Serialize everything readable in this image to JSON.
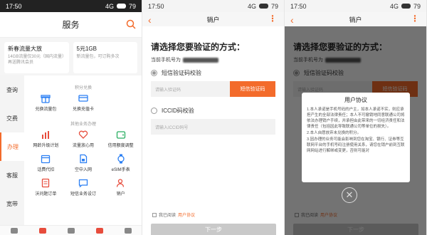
{
  "status": {
    "time": "17:50",
    "signal": "4G",
    "battery": "79"
  },
  "services": {
    "title": "服务",
    "promo": [
      {
        "title": "新春流量大放",
        "sub": "14GB流量仅30元（国内流量）再送腾讯会员"
      },
      {
        "title": "5元1GB",
        "sub": "新流量包，可订购多次"
      }
    ],
    "sidebar": [
      "查询",
      "交费",
      "办理",
      "客服",
      "宽带"
    ],
    "active_index": 2,
    "sections": [
      {
        "title": "积分兑换",
        "items": [
          {
            "label": "兑换流量包",
            "icon": "gift-icon"
          },
          {
            "label": "兑换充值卡",
            "icon": "card-icon"
          }
        ]
      },
      {
        "title": "其他业务办理",
        "items": [
          {
            "label": "网龄升级计划",
            "icon": "chart-icon"
          },
          {
            "label": "流量放心用",
            "icon": "heart-icon"
          },
          {
            "label": "信用额度调整",
            "icon": "wallet-icon"
          },
          {
            "label": "话费代扣",
            "icon": "calendar-icon"
          },
          {
            "label": "空中入网",
            "icon": "sim-icon"
          },
          {
            "label": "eSIM手表",
            "icon": "watch-icon"
          },
          {
            "label": "沃问题订单",
            "icon": "document-icon"
          },
          {
            "label": "短信业务设订",
            "icon": "message-icon"
          },
          {
            "label": "销户",
            "icon": "user-remove-icon"
          }
        ]
      }
    ]
  },
  "verify": {
    "title": "销户",
    "heading": "请选择您要验证的方式：",
    "phone_label": "当前手机号为",
    "sms_option": "短信验证码校验",
    "sms_placeholder": "请输入验证码",
    "sms_button": "短信验证码",
    "iccid_option": "ICCID码校验",
    "iccid_placeholder": "请输入ICCID码号",
    "agree_prefix": "我已阅读",
    "agree_link": "用户协议",
    "next": "下一步"
  },
  "agreement": {
    "title": "用户协议",
    "paragraphs": [
      "1.本人承诺是手机号码的户主，如本人承诺不实，则应承担产生的全部法律责任；本人不可撤销地同意联通公司将依法办理销户手续，并承担由此带来的一切经济责任和法律责任（包括因此导致联通公司等单位的损失）。",
      "2.本人自愿放弃未兑换的积分。",
      "3.因办理的业务可能会影响到您在淘宝、银行、证券等互联网平台的手机号码注册使用关系，请您在销户前到互联网网站进行解绑或变更，否则可能对"
    ]
  }
}
